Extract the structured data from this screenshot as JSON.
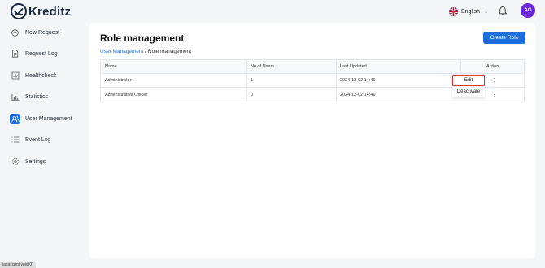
{
  "app": {
    "logo_text": "Kreditz",
    "language": "English",
    "avatar_initials": "AG"
  },
  "sidebar": {
    "items": [
      {
        "label": "New Request",
        "icon": "plus-circle-icon",
        "active": false
      },
      {
        "label": "Request Log",
        "icon": "document-icon",
        "active": false
      },
      {
        "label": "Healthcheck",
        "icon": "health-icon",
        "active": false
      },
      {
        "label": "Statistics",
        "icon": "bar-chart-icon",
        "active": false
      },
      {
        "label": "User Management",
        "icon": "users-icon",
        "active": true
      },
      {
        "label": "Event Log",
        "icon": "list-icon",
        "active": false
      },
      {
        "label": "Settings",
        "icon": "gear-icon",
        "active": false
      }
    ]
  },
  "main": {
    "title": "Role management",
    "create_button": "Create Role",
    "breadcrumb": {
      "link": "User Management",
      "separator": " / ",
      "current": "Role management"
    },
    "table": {
      "headers": {
        "name": "Name",
        "users": "No.of Users",
        "updated": "Last Updated",
        "action": "Action"
      },
      "rows": [
        {
          "name": "Administrator",
          "users": "1",
          "updated": "2024-12-02 14:46"
        },
        {
          "name": "Administrative Officer",
          "users": "0",
          "updated": "2024-12-02 14:46"
        }
      ]
    },
    "menu": {
      "edit": "Edit",
      "deactivate": "Deactivate"
    }
  },
  "status_bar": "javascript:void(0)",
  "colors": {
    "accent": "#1d6fdc",
    "avatar": "#6d28d9",
    "highlight": "#d93a2b"
  }
}
